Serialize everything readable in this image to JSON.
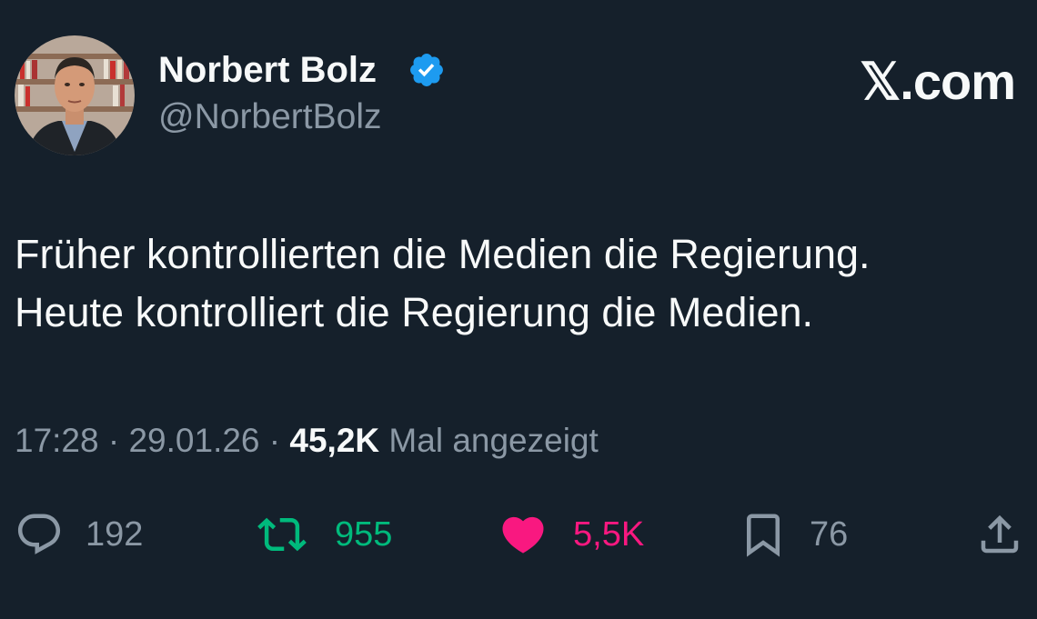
{
  "author": {
    "name": "Norbert Bolz",
    "handle": "@NorbertBolz",
    "verified": true
  },
  "brand": "𝕏.com",
  "tweet": {
    "lines": [
      "Früher kontrollierten die Medien die Regierung.",
      "Heute kontrolliert die Regierung die Medien."
    ]
  },
  "meta": {
    "time": "17:28",
    "separator_1": " · ",
    "date": "29.01.26",
    "separator_2": " · ",
    "views_count": "45,2K",
    "views_label": " Mal angezeigt"
  },
  "actions": {
    "reply": {
      "icon": "reply-icon",
      "count": "192"
    },
    "retweet": {
      "icon": "retweet-icon",
      "count": "955"
    },
    "like": {
      "icon": "heart-icon",
      "count": "5,5K"
    },
    "bookmark": {
      "icon": "bookmark-icon",
      "count": "76"
    },
    "share": {
      "icon": "share-icon"
    }
  },
  "colors": {
    "background": "#15202b",
    "text_primary": "#f7f9f9",
    "text_secondary": "#8b98a5",
    "verified": "#1d9bf0",
    "retweet": "#00ba7c",
    "like": "#f91880"
  }
}
